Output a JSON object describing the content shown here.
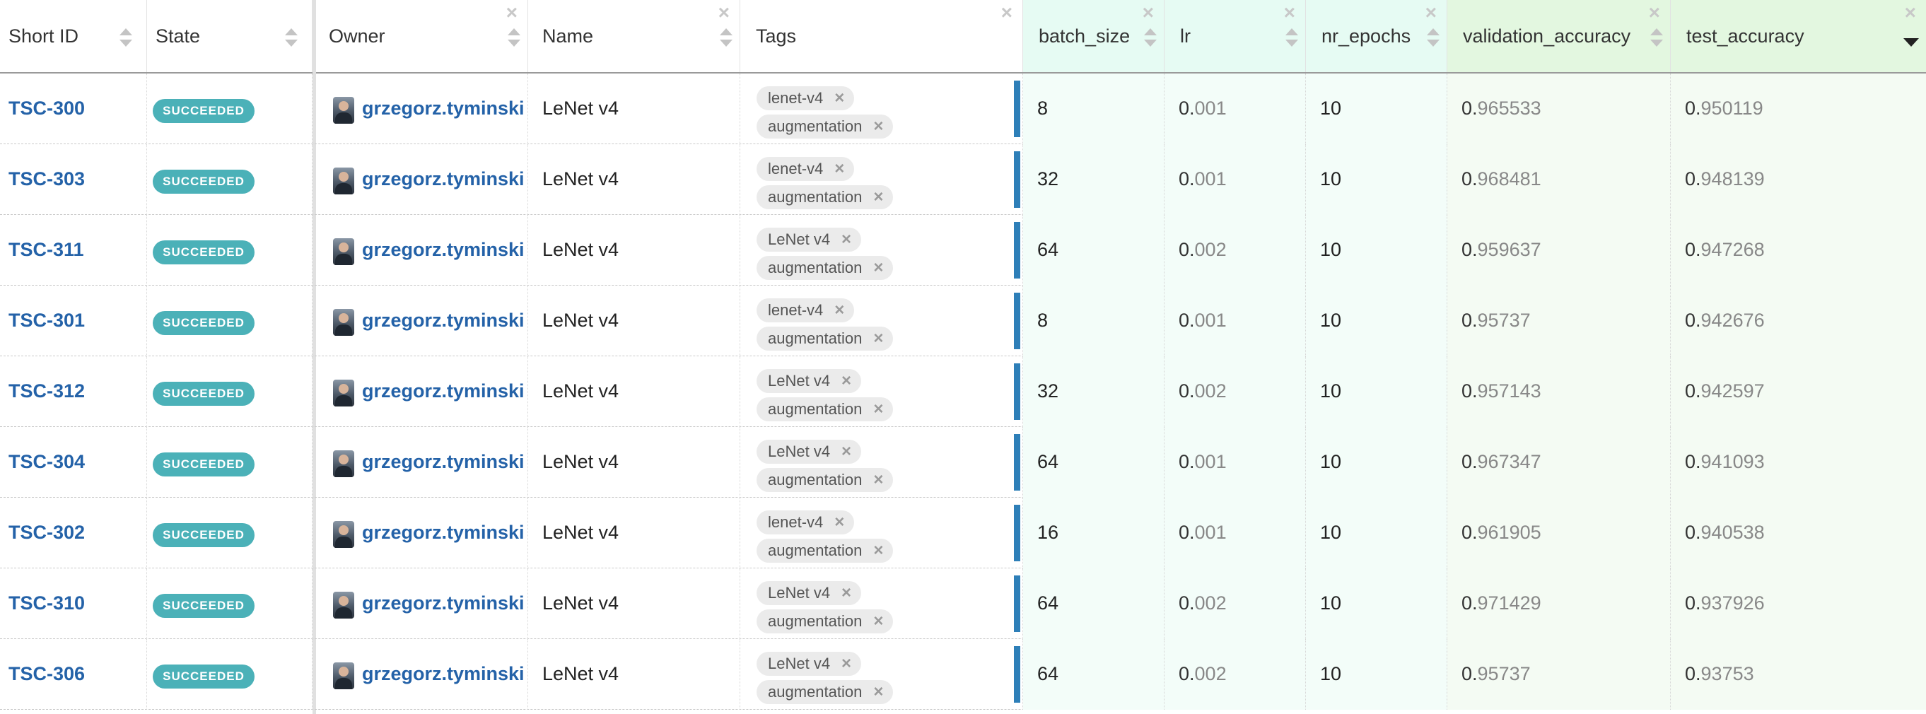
{
  "columns": {
    "short_id": "Short ID",
    "state": "State",
    "owner": "Owner",
    "name": "Name",
    "tags": "Tags",
    "batch_size": "batch_size",
    "lr": "lr",
    "nr_epochs": "nr_epochs",
    "validation_accuracy": "validation_accuracy",
    "test_accuracy": "test_accuracy"
  },
  "icons": {
    "remove_column": "close-icon",
    "sort": "sort-arrows-icon",
    "sorted_desc": "caret-down-icon",
    "tag_remove": "close-icon"
  },
  "colors": {
    "link": "#2462a8",
    "state_badge": "#4bb1b8",
    "parameter_header": "#e6fbf3",
    "metric_header": "#e3f7e0",
    "row_bar": "#2e7fb8"
  },
  "sorted_by": "test_accuracy",
  "sort_direction": "descending",
  "tag_remove_glyph": "×",
  "rows": [
    {
      "id": "TSC-300",
      "state": "SUCCEEDED",
      "owner": "grzegorz.tyminski",
      "name": "LeNet v4",
      "tags": [
        "lenet-v4",
        "augmentation"
      ],
      "batch_size": "8",
      "lr": {
        "int": "0.",
        "dec": "001"
      },
      "nr_epochs": "10",
      "val": {
        "int": "0.",
        "dec": "965533"
      },
      "test": {
        "int": "0.",
        "dec": "950119"
      }
    },
    {
      "id": "TSC-303",
      "state": "SUCCEEDED",
      "owner": "grzegorz.tyminski",
      "name": "LeNet v4",
      "tags": [
        "lenet-v4",
        "augmentation"
      ],
      "batch_size": "32",
      "lr": {
        "int": "0.",
        "dec": "001"
      },
      "nr_epochs": "10",
      "val": {
        "int": "0.",
        "dec": "968481"
      },
      "test": {
        "int": "0.",
        "dec": "948139"
      }
    },
    {
      "id": "TSC-311",
      "state": "SUCCEEDED",
      "owner": "grzegorz.tyminski",
      "name": "LeNet v4",
      "tags": [
        "LeNet v4",
        "augmentation"
      ],
      "batch_size": "64",
      "lr": {
        "int": "0.",
        "dec": "002"
      },
      "nr_epochs": "10",
      "val": {
        "int": "0.",
        "dec": "959637"
      },
      "test": {
        "int": "0.",
        "dec": "947268"
      }
    },
    {
      "id": "TSC-301",
      "state": "SUCCEEDED",
      "owner": "grzegorz.tyminski",
      "name": "LeNet v4",
      "tags": [
        "lenet-v4",
        "augmentation"
      ],
      "batch_size": "8",
      "lr": {
        "int": "0.",
        "dec": "001"
      },
      "nr_epochs": "10",
      "val": {
        "int": "0.",
        "dec": "95737"
      },
      "test": {
        "int": "0.",
        "dec": "942676"
      }
    },
    {
      "id": "TSC-312",
      "state": "SUCCEEDED",
      "owner": "grzegorz.tyminski",
      "name": "LeNet v4",
      "tags": [
        "LeNet v4",
        "augmentation"
      ],
      "batch_size": "32",
      "lr": {
        "int": "0.",
        "dec": "002"
      },
      "nr_epochs": "10",
      "val": {
        "int": "0.",
        "dec": "957143"
      },
      "test": {
        "int": "0.",
        "dec": "942597"
      }
    },
    {
      "id": "TSC-304",
      "state": "SUCCEEDED",
      "owner": "grzegorz.tyminski",
      "name": "LeNet v4",
      "tags": [
        "LeNet v4",
        "augmentation"
      ],
      "batch_size": "64",
      "lr": {
        "int": "0.",
        "dec": "001"
      },
      "nr_epochs": "10",
      "val": {
        "int": "0.",
        "dec": "967347"
      },
      "test": {
        "int": "0.",
        "dec": "941093"
      }
    },
    {
      "id": "TSC-302",
      "state": "SUCCEEDED",
      "owner": "grzegorz.tyminski",
      "name": "LeNet v4",
      "tags": [
        "lenet-v4",
        "augmentation"
      ],
      "batch_size": "16",
      "lr": {
        "int": "0.",
        "dec": "001"
      },
      "nr_epochs": "10",
      "val": {
        "int": "0.",
        "dec": "961905"
      },
      "test": {
        "int": "0.",
        "dec": "940538"
      }
    },
    {
      "id": "TSC-310",
      "state": "SUCCEEDED",
      "owner": "grzegorz.tyminski",
      "name": "LeNet v4",
      "tags": [
        "LeNet v4",
        "augmentation"
      ],
      "batch_size": "64",
      "lr": {
        "int": "0.",
        "dec": "002"
      },
      "nr_epochs": "10",
      "val": {
        "int": "0.",
        "dec": "971429"
      },
      "test": {
        "int": "0.",
        "dec": "937926"
      }
    },
    {
      "id": "TSC-306",
      "state": "SUCCEEDED",
      "owner": "grzegorz.tyminski",
      "name": "LeNet v4",
      "tags": [
        "LeNet v4",
        "augmentation"
      ],
      "batch_size": "64",
      "lr": {
        "int": "0.",
        "dec": "002"
      },
      "nr_epochs": "10",
      "val": {
        "int": "0.",
        "dec": "95737"
      },
      "test": {
        "int": "0.",
        "dec": "93753"
      }
    }
  ]
}
